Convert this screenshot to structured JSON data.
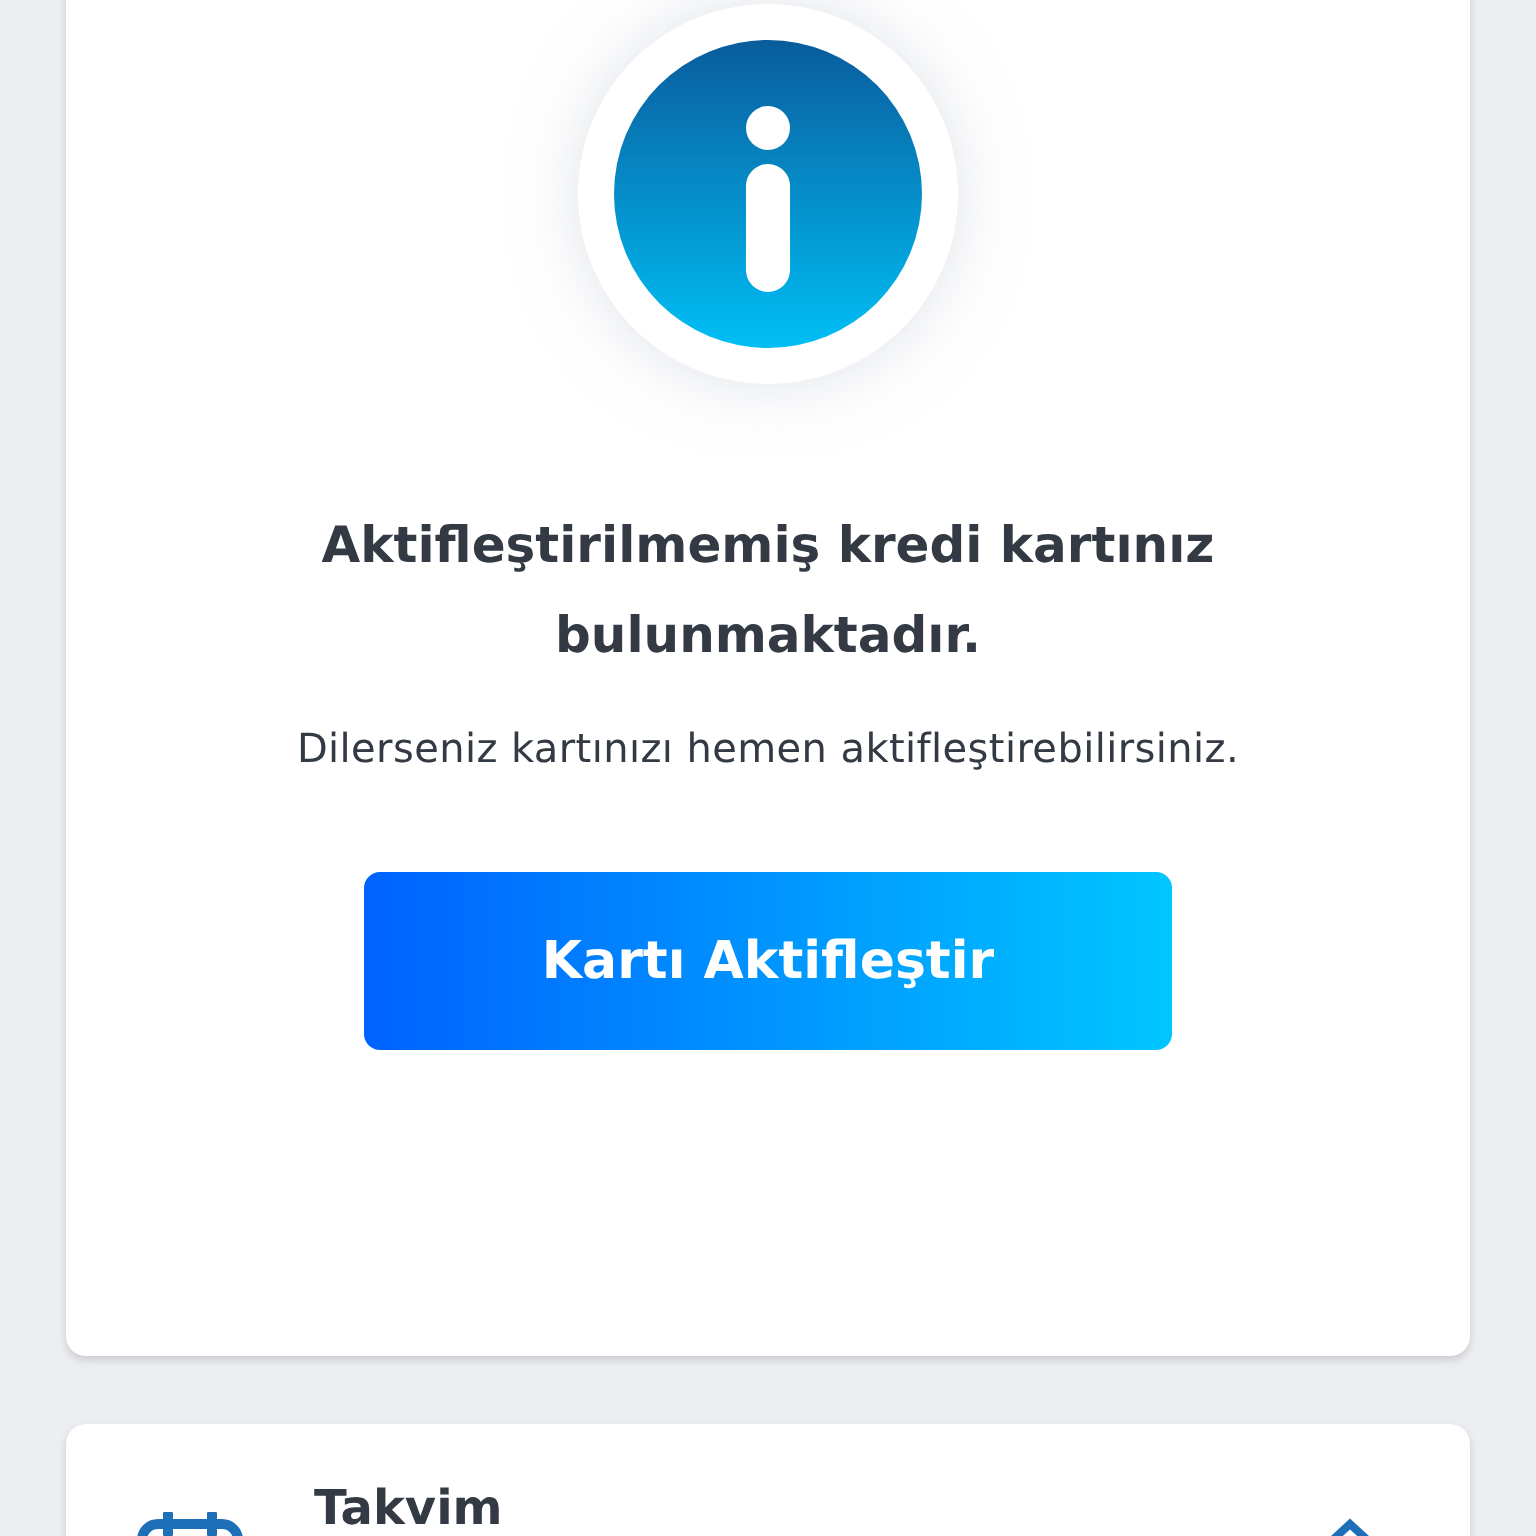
{
  "info_card": {
    "title": "Aktifleştirilmemiş kredi kartınız bulunmaktadır.",
    "message": "Dilerseniz kartınızı hemen aktifleştirebilirsiniz.",
    "button": "Kartı Aktifleştir"
  },
  "calendar_card": {
    "title": "Takvim",
    "expanded": true
  }
}
